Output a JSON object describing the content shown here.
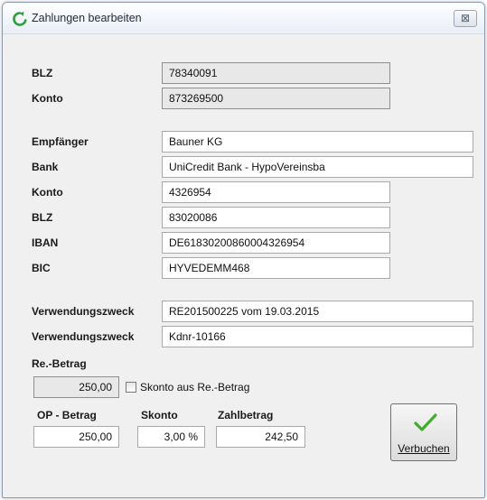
{
  "window": {
    "title": "Zahlungen bearbeiten",
    "close_symbol": "⊠"
  },
  "debtor": {
    "blz_label": "BLZ",
    "blz_value": "78340091",
    "konto_label": "Konto",
    "konto_value": "873269500"
  },
  "recipient": {
    "empfaenger_label": "Empfänger",
    "empfaenger_value": "Bauner KG",
    "bank_label": "Bank",
    "bank_value": "UniCredit Bank - HypoVereinsba",
    "konto_label": "Konto",
    "konto_value": "4326954",
    "blz_label": "BLZ",
    "blz_value": "83020086",
    "iban_label": "IBAN",
    "iban_value": "DE61830200860004326954",
    "bic_label": "BIC",
    "bic_value": "HYVEDEMM468"
  },
  "purpose": {
    "label1": "Verwendungszweck",
    "value1": "RE201500225 vom 19.03.2015",
    "label2": "Verwendungszweck",
    "value2": "Kdnr-10166"
  },
  "amounts": {
    "re_betrag_label": "Re.-Betrag",
    "re_betrag_value": "250,00",
    "skonto_checkbox_label": "Skonto aus Re.-Betrag",
    "skonto_checkbox_checked": false,
    "op_betrag_label": "OP - Betrag",
    "op_betrag_value": "250,00",
    "skonto_label": "Skonto",
    "skonto_value": "3,00 %",
    "zahlbetrag_label": "Zahlbetrag",
    "zahlbetrag_value": "242,50"
  },
  "actions": {
    "book_label": "Verbuchen",
    "book_icon": "green-checkmark-icon"
  },
  "colors": {
    "check_green": "#3fae2a",
    "title_icon_green": "#2e9e3a"
  }
}
